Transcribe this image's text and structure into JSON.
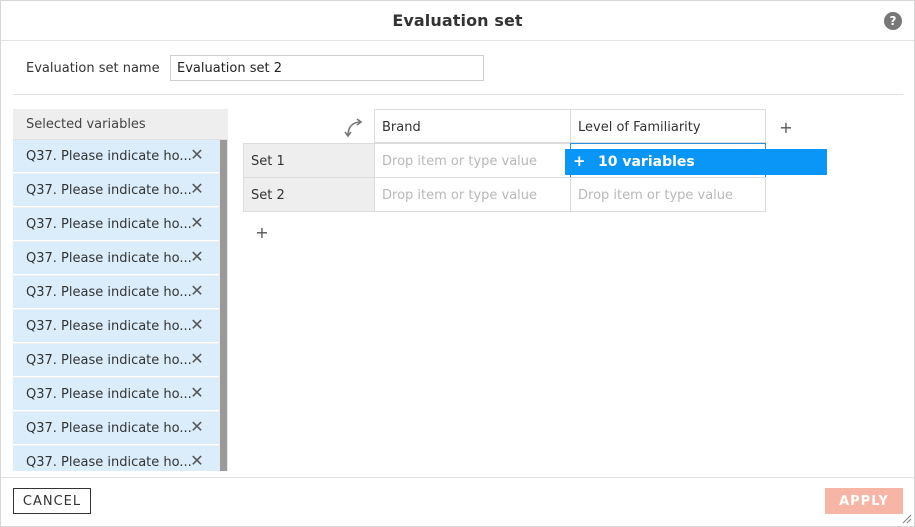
{
  "dialog": {
    "title": "Evaluation set",
    "help_glyph": "?"
  },
  "name_field": {
    "label": "Evaluation set name",
    "value": "Evaluation set 2"
  },
  "variables": {
    "header": "Selected variables",
    "items": [
      "Q37. Please indicate ho...",
      "Q37. Please indicate ho...",
      "Q37. Please indicate ho...",
      "Q37. Please indicate ho...",
      "Q37. Please indicate ho...",
      "Q37. Please indicate ho...",
      "Q37. Please indicate ho...",
      "Q37. Please indicate ho...",
      "Q37. Please indicate ho...",
      "Q37. Please indicate ho..."
    ],
    "remove_glyph": "✕"
  },
  "grid": {
    "columns": [
      "Brand",
      "Level of Familiarity"
    ],
    "rows": [
      "Set 1",
      "Set 2"
    ],
    "cell_placeholder": "Drop item or type value",
    "add_glyph": "+"
  },
  "drag_tooltip": {
    "plus": "+",
    "label": "10 variables"
  },
  "footer": {
    "cancel_label": "CANCEL",
    "apply_label": "APPLY"
  },
  "colors": {
    "accent_blue": "#0a96f6",
    "selected_bg": "#dbecfb",
    "apply_disabled": "#f7b5a5"
  }
}
